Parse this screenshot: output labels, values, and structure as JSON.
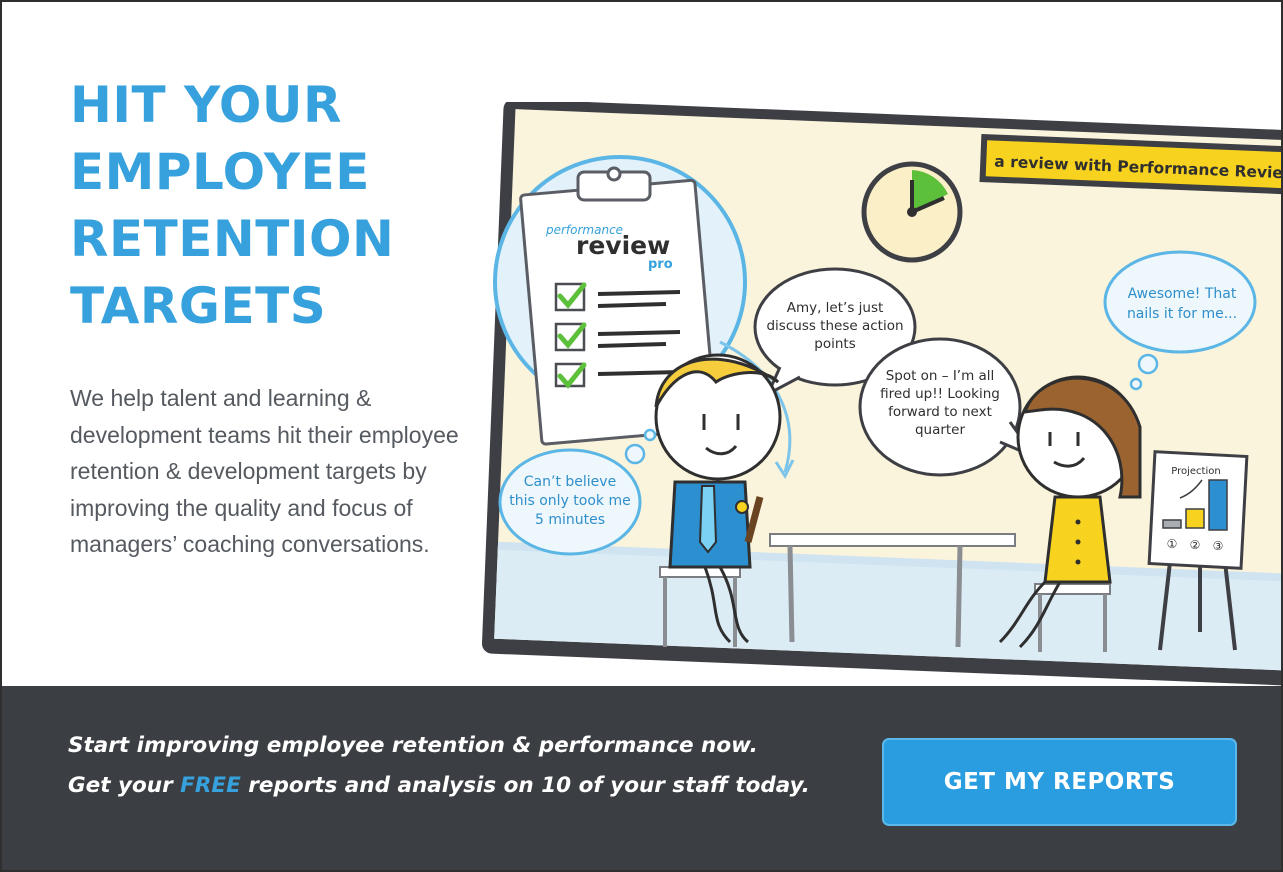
{
  "hero": {
    "headline_lines": [
      "HIT YOUR",
      "EMPLOYEE",
      "RETENTION",
      "TARGETS"
    ],
    "description": "We help talent and learning & development teams hit their employee retention & development targets by improving the quality and focus of managers’ coaching conversations."
  },
  "illustration": {
    "banner": "a review with Performance Review Pro",
    "clipboard_brand_top": "performance",
    "clipboard_brand_main": "review",
    "clipboard_brand_sub": "pro",
    "bubble_manager": [
      "Amy, let’s just",
      "discuss these action",
      "points"
    ],
    "bubble_employee": [
      "Spot on – I’m all",
      "fired up!! Looking",
      "forward to next",
      "quarter"
    ],
    "thought_manager": [
      "Can’t believe",
      "this only took me",
      "5 minutes"
    ],
    "thought_employee": [
      "Awesome! That",
      "nails it for me..."
    ],
    "chart_title": "Projection",
    "chart_labels": [
      "①",
      "②",
      "③"
    ]
  },
  "cta": {
    "line1": "Start improving employee retention & performance now.",
    "line2_prefix": "Get your ",
    "line2_free": "FREE",
    "line2_suffix": " reports and analysis on 10 of your staff today.",
    "button_label": "GET MY REPORTS"
  },
  "colors": {
    "brand_blue": "#36a1dc",
    "button_blue": "#2a9de0",
    "dark_bar": "#3b3e42",
    "text_gray": "#555a60",
    "clock_green": "#5cc03a",
    "banner_yellow": "#f7d21e"
  }
}
